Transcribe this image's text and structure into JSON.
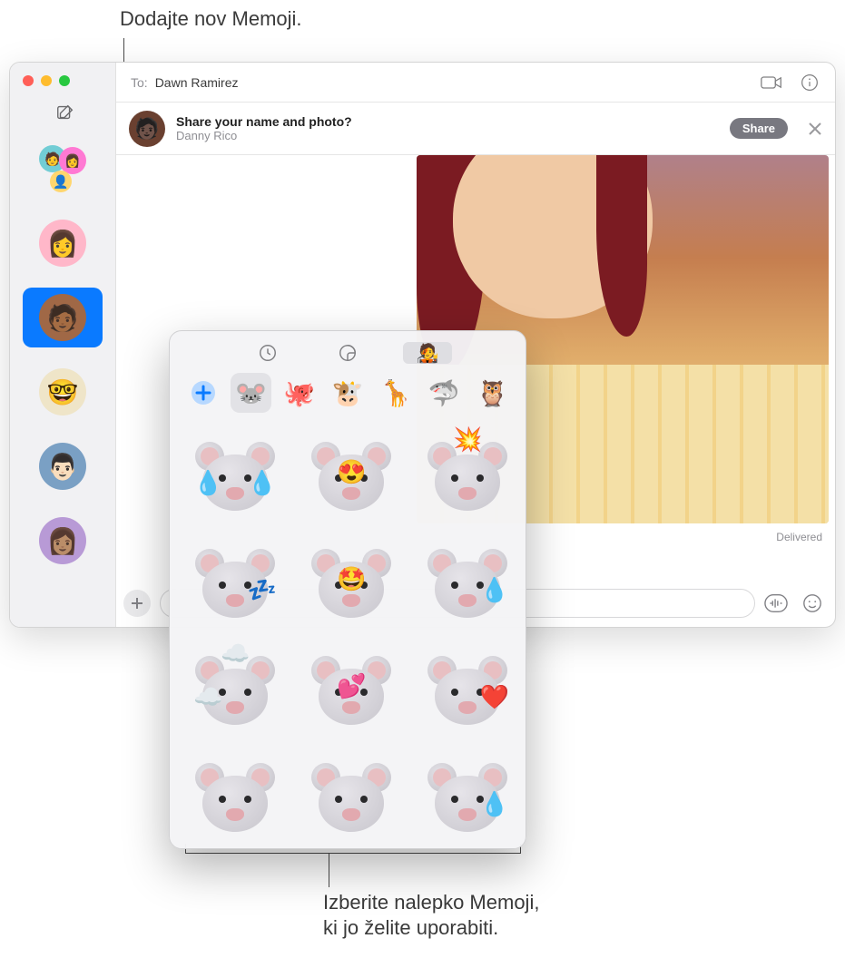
{
  "callouts": {
    "top": "Dodajte nov Memoji.",
    "bottom_line1": "Izberite nalepko Memoji,",
    "bottom_line2": "ki jo želite uporabiti."
  },
  "header": {
    "to_label": "To:",
    "to_name": "Dawn Ramirez"
  },
  "share_bar": {
    "title": "Share your name and photo?",
    "subtitle": "Danny Rico",
    "button": "Share"
  },
  "chat": {
    "delivered": "Delivered"
  },
  "input": {
    "placeholder": ""
  },
  "sidebar": {
    "items": [
      {
        "kind": "group"
      },
      {
        "kind": "memoji-pink"
      },
      {
        "kind": "memoji-brown-selected"
      },
      {
        "kind": "memoji-glasses"
      },
      {
        "kind": "photo-man"
      },
      {
        "kind": "memoji-purple"
      }
    ]
  },
  "popover": {
    "tabs": [
      {
        "name": "recents",
        "icon": "clock",
        "selected": false
      },
      {
        "name": "stickers",
        "icon": "slice",
        "selected": false
      },
      {
        "name": "memoji",
        "icon": "memoji",
        "selected": true
      }
    ],
    "characters": [
      {
        "name": "add",
        "emoji": "＋"
      },
      {
        "name": "mouse",
        "emoji": "🐭",
        "selected": true
      },
      {
        "name": "octopus",
        "emoji": "🐙"
      },
      {
        "name": "cow",
        "emoji": "🐮"
      },
      {
        "name": "giraffe",
        "emoji": "🦒"
      },
      {
        "name": "shark",
        "emoji": "🦈"
      },
      {
        "name": "owl",
        "emoji": "🦉"
      }
    ],
    "stickers": [
      {
        "name": "mouse-laugh-tears",
        "overlay_l": "💧",
        "overlay_r": "💧"
      },
      {
        "name": "mouse-heart-eyes",
        "overlay_c": "😍"
      },
      {
        "name": "mouse-mind-blown",
        "overlay_t": "💥"
      },
      {
        "name": "mouse-sleep",
        "overlay_r": "💤"
      },
      {
        "name": "mouse-star-eyes",
        "overlay_c": "🤩"
      },
      {
        "name": "mouse-tear",
        "overlay_r": "💧"
      },
      {
        "name": "mouse-clouds",
        "overlay_l": "☁️",
        "overlay_t": "☁️"
      },
      {
        "name": "mouse-kiss-hearts",
        "overlay_c": "💕"
      },
      {
        "name": "mouse-single-heart",
        "overlay_r": "❤️"
      },
      {
        "name": "mouse-worried"
      },
      {
        "name": "mouse-angry"
      },
      {
        "name": "mouse-sweat",
        "overlay_r": "💧"
      }
    ]
  }
}
